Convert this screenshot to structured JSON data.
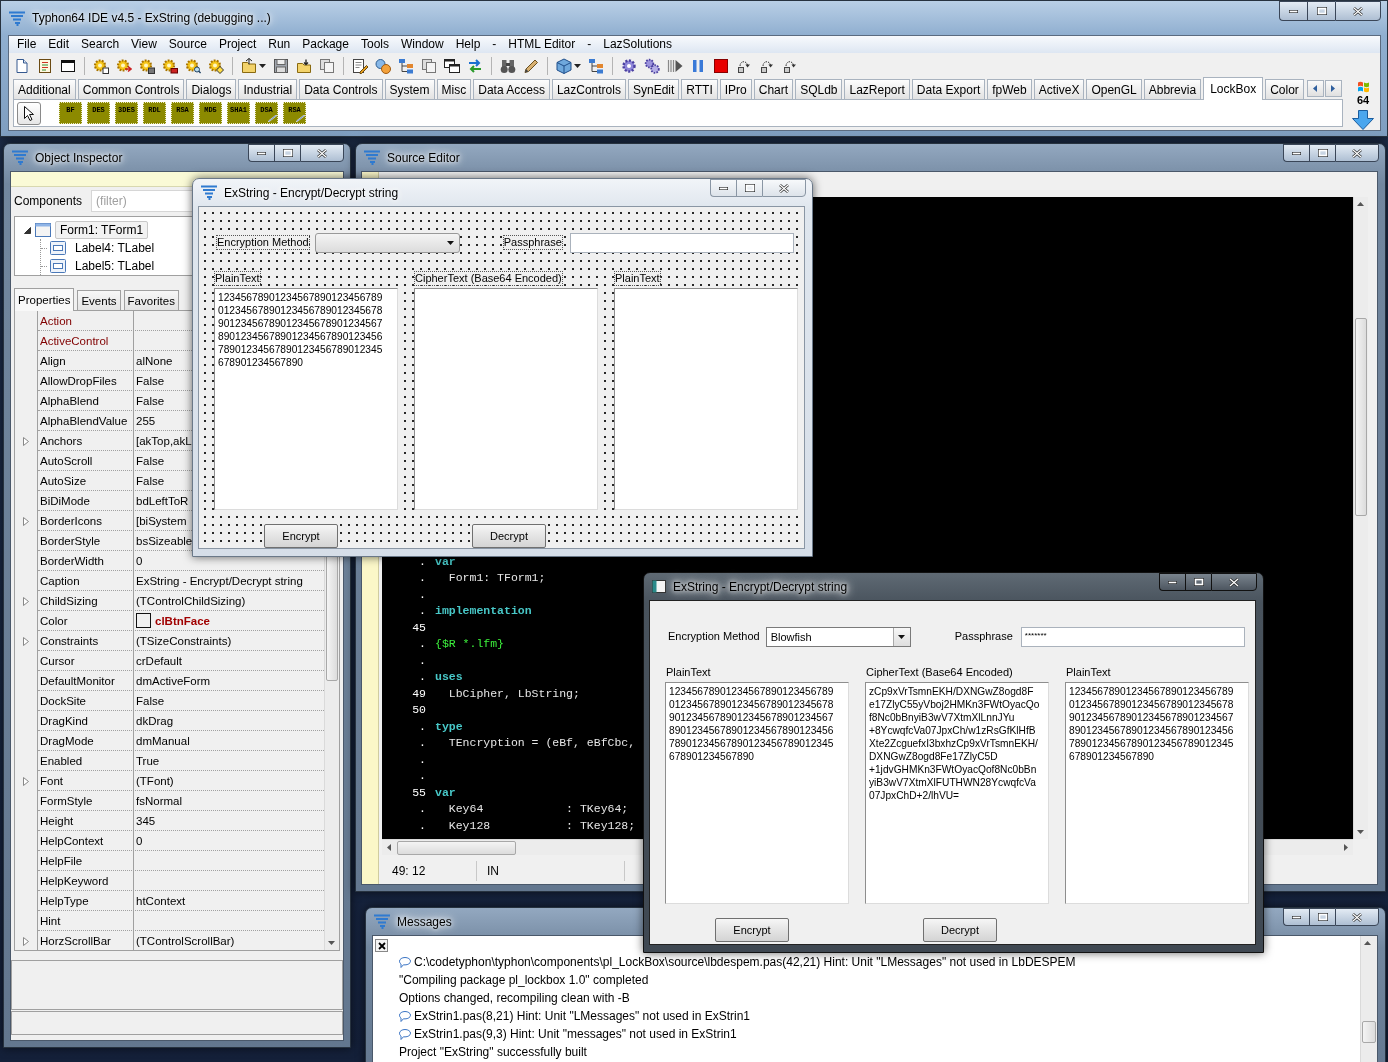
{
  "ide": {
    "title": "Typhon64 IDE v4.5 - ExString (debugging ...)",
    "menu": [
      "File",
      "Edit",
      "Search",
      "View",
      "Source",
      "Project",
      "Run",
      "Package",
      "Tools",
      "Window",
      "Help",
      "-",
      "HTML Editor",
      "-",
      "LazSolutions"
    ],
    "palette_tabs": [
      {
        "label": "Additional",
        "selected": false
      },
      {
        "label": "Common Controls",
        "selected": false
      },
      {
        "label": "Dialogs",
        "selected": false
      },
      {
        "label": "Industrial",
        "selected": false
      },
      {
        "label": "Data Controls",
        "selected": false
      },
      {
        "label": "System",
        "selected": false
      },
      {
        "label": "Misc",
        "selected": false
      },
      {
        "label": "Data Access",
        "selected": false
      },
      {
        "label": "LazControls",
        "selected": false
      },
      {
        "label": "SynEdit",
        "selected": false
      },
      {
        "label": "RTTI",
        "selected": false
      },
      {
        "label": "IPro",
        "selected": false
      },
      {
        "label": "Chart",
        "selected": false
      },
      {
        "label": "SQLdb",
        "selected": false
      },
      {
        "label": "LazReport",
        "selected": false
      },
      {
        "label": "Data Export",
        "selected": false
      },
      {
        "label": "fpWeb",
        "selected": false
      },
      {
        "label": "ActiveX",
        "selected": false
      },
      {
        "label": "OpenGL",
        "selected": false
      },
      {
        "label": "Abbrevia",
        "selected": false
      },
      {
        "label": "LockBox",
        "selected": true
      },
      {
        "label": "Color",
        "selected": false
      }
    ],
    "components": [
      {
        "label": "BF",
        "kind": "cipher"
      },
      {
        "label": "DES",
        "kind": "cipher"
      },
      {
        "label": "3DES",
        "kind": "cipher"
      },
      {
        "label": "RDL",
        "kind": "cipher"
      },
      {
        "label": "RSA",
        "kind": "cipher"
      },
      {
        "label": "MD5",
        "kind": "cipher"
      },
      {
        "label": "SHA1",
        "kind": "cipher"
      },
      {
        "label": "DSA",
        "kind": "signature"
      },
      {
        "label": "RSA",
        "kind": "signature"
      }
    ],
    "bitness": "64"
  },
  "object_inspector": {
    "title": "Object Inspector",
    "components_label": "Components",
    "filter_placeholder": "(filter)",
    "tree": [
      {
        "label": "Form1: TForm1",
        "selected": true,
        "expanded": true,
        "children": [
          {
            "label": "Label4: TLabel",
            "selected": false
          },
          {
            "label": "Label5: TLabel",
            "selected": false
          }
        ]
      }
    ],
    "tabs": [
      {
        "label": "Properties",
        "selected": true
      },
      {
        "label": "Events",
        "selected": false
      },
      {
        "label": "Favorites",
        "selected": false
      }
    ],
    "properties": [
      {
        "name": "Action",
        "kind": "reference",
        "expandable": false
      },
      {
        "name": "ActiveControl",
        "kind": "reference",
        "expandable": false
      },
      {
        "name": "Align",
        "value": "alNone",
        "kind": "plain",
        "expandable": false
      },
      {
        "name": "AllowDropFiles",
        "value": "False",
        "kind": "plain",
        "expandable": false
      },
      {
        "name": "AlphaBlend",
        "value": "False",
        "kind": "plain",
        "expandable": false
      },
      {
        "name": "AlphaBlendValue",
        "value": "255",
        "kind": "plain",
        "expandable": false
      },
      {
        "name": "Anchors",
        "value": "[akTop,akL",
        "kind": "plain",
        "expandable": true
      },
      {
        "name": "AutoScroll",
        "value": "False",
        "kind": "plain",
        "expandable": false
      },
      {
        "name": "AutoSize",
        "value": "False",
        "kind": "plain",
        "expandable": false
      },
      {
        "name": "BiDiMode",
        "value": "bdLeftToR",
        "kind": "plain",
        "expandable": false
      },
      {
        "name": "BorderIcons",
        "value": "[biSystem",
        "kind": "plain",
        "expandable": true
      },
      {
        "name": "BorderStyle",
        "value": "bsSizeable",
        "kind": "plain",
        "expandable": false
      },
      {
        "name": "BorderWidth",
        "value": "0",
        "kind": "plain",
        "expandable": false
      },
      {
        "name": "Caption",
        "value": "ExString - Encrypt/Decrypt string",
        "kind": "plain",
        "expandable": false
      },
      {
        "name": "ChildSizing",
        "value": "(TControlChildSizing)",
        "kind": "plain",
        "expandable": true
      },
      {
        "name": "Color",
        "value": "clBtnFace",
        "kind": "color",
        "expandable": false
      },
      {
        "name": "Constraints",
        "value": "(TSizeConstraints)",
        "kind": "plain",
        "expandable": true
      },
      {
        "name": "Cursor",
        "value": "crDefault",
        "kind": "plain",
        "expandable": false
      },
      {
        "name": "DefaultMonitor",
        "value": "dmActiveForm",
        "kind": "plain",
        "expandable": false
      },
      {
        "name": "DockSite",
        "value": "False",
        "kind": "plain",
        "expandable": false
      },
      {
        "name": "DragKind",
        "value": "dkDrag",
        "kind": "plain",
        "expandable": false
      },
      {
        "name": "DragMode",
        "value": "dmManual",
        "kind": "plain",
        "expandable": false
      },
      {
        "name": "Enabled",
        "value": "True",
        "kind": "plain",
        "expandable": false
      },
      {
        "name": "Font",
        "value": "(TFont)",
        "kind": "plain",
        "expandable": true
      },
      {
        "name": "FormStyle",
        "value": "fsNormal",
        "kind": "plain",
        "expandable": false
      },
      {
        "name": "Height",
        "value": "345",
        "kind": "plain",
        "expandable": false
      },
      {
        "name": "HelpContext",
        "value": "0",
        "kind": "plain",
        "expandable": false
      },
      {
        "name": "HelpFile",
        "kind": "plain",
        "expandable": false
      },
      {
        "name": "HelpKeyword",
        "kind": "plain",
        "expandable": false
      },
      {
        "name": "HelpType",
        "value": "htContext",
        "kind": "plain",
        "expandable": false
      },
      {
        "name": "Hint",
        "kind": "plain",
        "expandable": false
      },
      {
        "name": "HorzScrollBar",
        "value": "(TControlScrollBar)",
        "kind": "plain",
        "expandable": true
      }
    ]
  },
  "source_editor": {
    "title": "Source Editor",
    "lines": [
      {
        "gutter": ".",
        "text": "var",
        "kind": "keyword"
      },
      {
        "gutter": ".",
        "text": "  Form1: TForm1;",
        "kind": "code"
      },
      {
        "gutter": "."
      },
      {
        "gutter": ".",
        "text": "implementation",
        "kind": "keyword"
      },
      {
        "gutter": "45"
      },
      {
        "gutter": ".",
        "text": "{$R *.lfm}",
        "kind": "directive"
      },
      {
        "gutter": "."
      },
      {
        "gutter": ".",
        "text": "uses",
        "kind": "keyword"
      },
      {
        "gutter": "49",
        "text": "  LbCipher, LbString;",
        "kind": "code"
      },
      {
        "gutter": "50"
      },
      {
        "gutter": ".",
        "text": "type",
        "kind": "keyword"
      },
      {
        "gutter": ".",
        "text": "  TEncryption = (eBf, eBfCbc,",
        "kind": "code"
      },
      {
        "gutter": "."
      },
      {
        "gutter": "."
      },
      {
        "gutter": "55",
        "text": "var",
        "kind": "keyword"
      },
      {
        "gutter": ".",
        "text": "  Key64            : TKey64;",
        "kind": "code"
      },
      {
        "gutter": ".",
        "text": "  Key128           : TKey128;",
        "kind": "code"
      }
    ],
    "status": [
      "49: 12",
      "IN"
    ]
  },
  "messages": {
    "title": "Messages",
    "items": [
      {
        "kind": "hint",
        "text": "C:\\codetyphon\\typhon\\components\\pl_LockBox\\source\\lbdespem.pas(42,21) Hint: Unit \"LMessages\" not used in LbDESPEM"
      },
      {
        "kind": "plain",
        "text": "\"Compiling package pl_lockbox 1.0\" completed"
      },
      {
        "kind": "plain",
        "text": "Options changed, recompiling clean with -B"
      },
      {
        "kind": "hint",
        "text": "ExStrin1.pas(8,21) Hint: Unit \"LMessages\" not used in ExStrin1"
      },
      {
        "kind": "hint",
        "text": "ExStrin1.pas(9,3) Hint: Unit \"messages\" not used in ExStrin1"
      },
      {
        "kind": "plain",
        "text": "Project \"ExString\" successfully built"
      }
    ]
  },
  "design_form": {
    "title": "ExString - Encrypt/Decrypt string",
    "active": false,
    "grid": true,
    "method_label": "Encryption Method",
    "passphrase_label": "Passphrase",
    "columns": [
      {
        "label": "PlainText",
        "lines": [
          "12345678901234567890123456789",
          "01234567890123456789012345678",
          "90123456789012345678901234567",
          "89012345678901234567890123456",
          "78901234567890123456789012345",
          "678901234567890"
        ]
      },
      {
        "label": "CipherText (Base64 Encoded)"
      },
      {
        "label": "PlainText"
      }
    ],
    "buttons": [
      "Encrypt",
      "Decrypt"
    ]
  },
  "running_form": {
    "title": "ExString - Encrypt/Decrypt string",
    "active": true,
    "grid": false,
    "method_label": "Encryption Method",
    "method_value": "Blowfish",
    "passphrase_label": "Passphrase",
    "passphrase_value": "*******",
    "columns": [
      {
        "label": "PlainText",
        "lines": [
          "12345678901234567890123456789",
          "01234567890123456789012345678",
          "90123456789012345678901234567",
          "89012345678901234567890123456",
          "78901234567890123456789012345",
          "678901234567890"
        ]
      },
      {
        "label": "CipherText (Base64 Encoded)",
        "lines": [
          "zCp9xVrTsmnEKH/DXNGwZ8ogd8F",
          "e17ZlyC55yVboj2HMKn3FWtOyacQo",
          "f8Nc0bBnyiB3wV7XtmXlLnnJYu",
          "+8YcwqfcVa07JpxCh/w1zRsGfKlHfB",
          "Xte2ZcguefxI3bxhzCp9xVrTsmnEKH/",
          "DXNGwZ8ogd8Fe17ZlyC5D",
          "+1jdvGHMKn3FWtOyacQof8Nc0bBn",
          "yiB3wV7XtmXlFUTHWN28YcwqfcVa",
          "07JpxChD+2/lhVU="
        ]
      },
      {
        "label": "PlainText",
        "lines": [
          "12345678901234567890123456789",
          "01234567890123456789012345678",
          "90123456789012345678901234567",
          "89012345678901234567890123456",
          "78901234567890123456789012345",
          "678901234567890"
        ]
      }
    ],
    "buttons": [
      "Encrypt",
      "Decrypt"
    ]
  }
}
